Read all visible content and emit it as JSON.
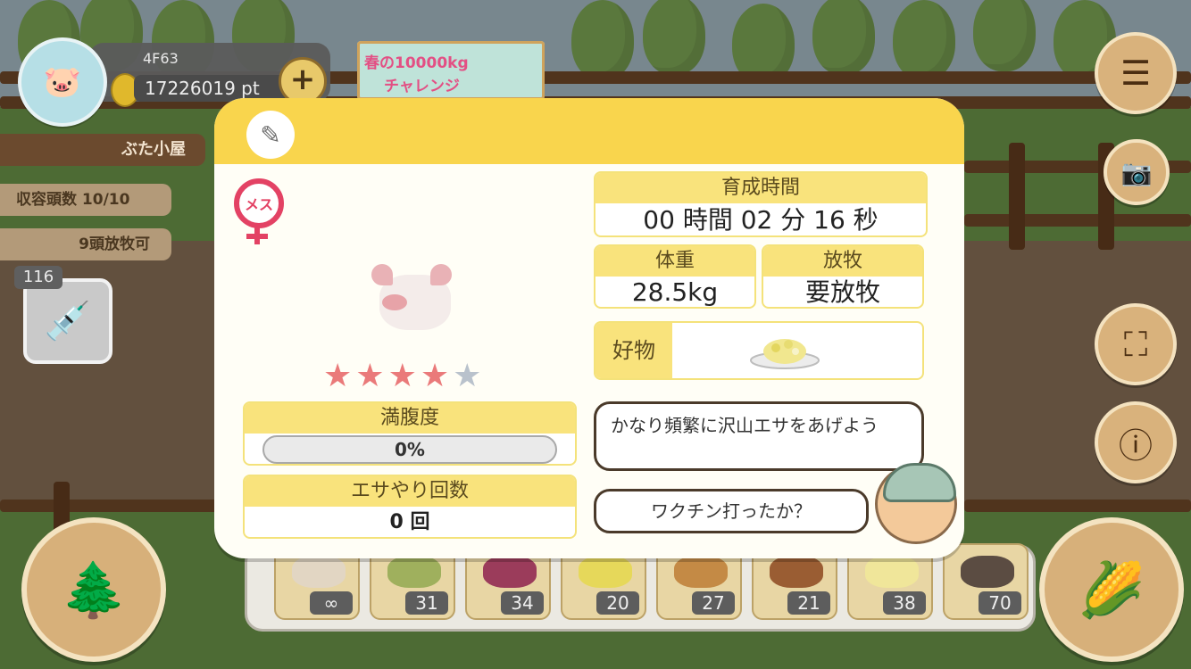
{
  "player": {
    "id": "4F63",
    "points": "17226019 pt",
    "avatar_icon": "pig-avatar-icon",
    "add_icon": "plus-icon"
  },
  "event_banner": {
    "line1": "春の10000kg",
    "line2": "チャレンジ"
  },
  "left_panel": {
    "barn": "ぶた小屋",
    "capacity": "収容頭数 10/10",
    "graze_available": "9頭放牧可",
    "vaccine_count": "116",
    "vaccine_icon": "syringe-icon"
  },
  "right_buttons": {
    "menu_icon": "hamburger-menu-icon",
    "camera_icon": "camera-icon",
    "focus_icon": "focus-frame-icon",
    "info_icon": "info-cycle-icon",
    "feed_icon": "corn-icon"
  },
  "bottom_left": {
    "trees_icon": "trees-icon"
  },
  "food_bar": {
    "items": [
      {
        "count": "∞",
        "color": "#e2d6c3"
      },
      {
        "count": "31",
        "color": "#9fb05d"
      },
      {
        "count": "34",
        "color": "#9b3c5b"
      },
      {
        "count": "20",
        "color": "#e6d85a"
      },
      {
        "count": "27",
        "color": "#c48a45"
      },
      {
        "count": "21",
        "color": "#9a5d33"
      },
      {
        "count": "38",
        "color": "#f0e69a"
      },
      {
        "count": "70",
        "color": "#5b4c42"
      }
    ]
  },
  "pig_modal": {
    "edit_icon": "pencil-icon",
    "gender_label": "メス",
    "stars_filled": 4,
    "stars_total": 5,
    "star_color_filled": "#ea7a7a",
    "star_color_empty": "#b9c2cc",
    "fullness": {
      "title": "満腹度",
      "value": "0%",
      "percent": 0
    },
    "feed_count": {
      "title": "エサやり回数",
      "value": "0 回"
    },
    "growth_time": {
      "title": "育成時間",
      "value": "00 時間 02 分 16 秒"
    },
    "weight": {
      "title": "体重",
      "value": "28.5kg"
    },
    "grazing": {
      "title": "放牧",
      "value": "要放牧"
    },
    "favorite": {
      "label": "好物",
      "icon": "food-plate-icon"
    },
    "advice1": "かなり頻繁に沢山エサをあげよう",
    "advice2": "ワクチン打ったか？"
  },
  "colors": {
    "header_yellow": "#f9d54d",
    "stat_yellow": "#f9e37c"
  }
}
